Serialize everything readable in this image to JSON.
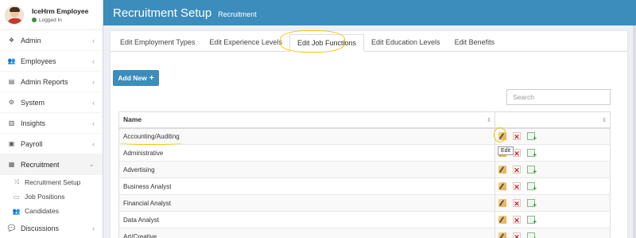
{
  "user": {
    "name": "IceHrm Employee",
    "status": "Logged In"
  },
  "sidebar": {
    "items": [
      {
        "label": "Admin",
        "icon": "cubes-icon",
        "glyph": "❖"
      },
      {
        "label": "Employees",
        "icon": "users-icon",
        "glyph": "👥"
      },
      {
        "label": "Admin Reports",
        "icon": "file-icon",
        "glyph": "▤"
      },
      {
        "label": "System",
        "icon": "cogs-icon",
        "glyph": "⚙"
      },
      {
        "label": "Insights",
        "icon": "bar-chart-icon",
        "glyph": "▥"
      },
      {
        "label": "Payroll",
        "icon": "calculator-icon",
        "glyph": "▣"
      },
      {
        "label": "Recruitment",
        "icon": "grid-icon",
        "glyph": "▦"
      },
      {
        "label": "Discussions",
        "icon": "comments-icon",
        "glyph": "💬"
      }
    ],
    "recruitment_sub": [
      {
        "label": "Recruitment Setup",
        "glyph": "⤨"
      },
      {
        "label": "Job Positions",
        "glyph": "▭"
      },
      {
        "label": "Candidates",
        "glyph": "👥"
      }
    ],
    "collapsed_chevron": "‹",
    "expanded_chevron": "⌄"
  },
  "header": {
    "title": "Recruitment Setup",
    "subtitle": "Recruitment"
  },
  "tabs": [
    "Edit Employment Types",
    "Edit Experience Levels",
    "Edit Job Functions",
    "Edit Education Levels",
    "Edit Benefits"
  ],
  "active_tab": 2,
  "toolbar": {
    "add_label": "Add New",
    "add_icon": "+"
  },
  "search": {
    "placeholder": "Search"
  },
  "table": {
    "column_name": "Name",
    "sort_icon": "⇕",
    "rows": [
      "Accounting/Auditing",
      "Administrative",
      "Advertising",
      "Business Analyst",
      "Financial Analyst",
      "Data Analyst",
      "Art/Creative"
    ]
  },
  "tooltip": "Edit",
  "colors": {
    "header": "#3c8dbc",
    "annotation": "#f2c40a",
    "delete": "#d02020"
  }
}
